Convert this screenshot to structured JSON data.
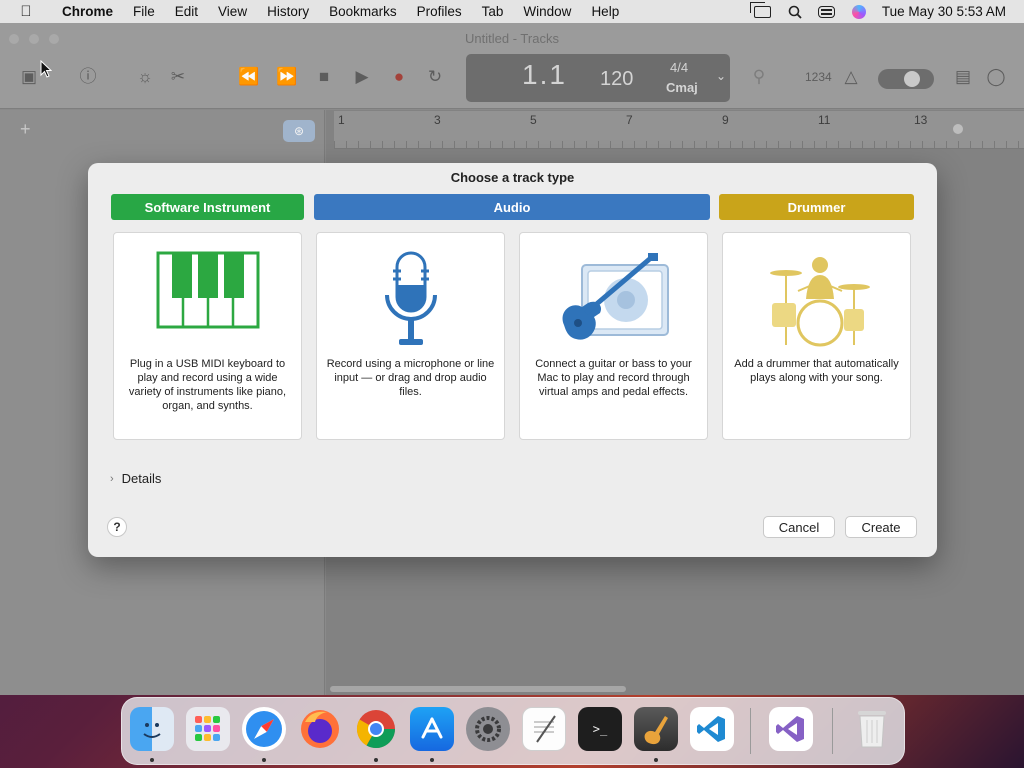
{
  "menubar": {
    "app_name": "Chrome",
    "items": [
      "File",
      "Edit",
      "View",
      "History",
      "Bookmarks",
      "Profiles",
      "Tab",
      "Window",
      "Help"
    ],
    "datetime": "Tue May 30  5:53 AM"
  },
  "window": {
    "title": "Untitled - Tracks",
    "lcd": {
      "position": "1.1",
      "tempo": "120",
      "time_signature": "4/4",
      "key": "Cmaj"
    },
    "ruler_numbers": [
      "1",
      "3",
      "5",
      "7",
      "9",
      "11",
      "13"
    ],
    "counter": "1234"
  },
  "dialog": {
    "title": "Choose a track type",
    "categories": [
      {
        "label": "Software Instrument",
        "color": "#28a745"
      },
      {
        "label": "Audio",
        "color": "#3a78c0"
      },
      {
        "label": "Drummer",
        "color": "#c9a41a"
      }
    ],
    "cards": [
      {
        "name": "software-instrument",
        "desc": "Plug in a USB MIDI keyboard to play and record using a wide variety of instruments like piano, organ, and synths."
      },
      {
        "name": "microphone",
        "desc": "Record using a microphone or line input — or drag and drop audio files."
      },
      {
        "name": "guitar",
        "desc": "Connect a guitar or bass to your Mac to play and record through virtual amps and pedal effects."
      },
      {
        "name": "drummer",
        "desc": "Add a drummer that automatically plays along with your song."
      }
    ],
    "details_label": "Details",
    "help_label": "?",
    "cancel_label": "Cancel",
    "create_label": "Create"
  },
  "dock": {
    "apps": [
      "finder-icon",
      "launchpad-icon",
      "safari-icon",
      "firefox-icon",
      "chrome-icon",
      "app-store-icon",
      "system-settings-icon",
      "textedit-icon",
      "terminal-icon",
      "garageband-icon",
      "vscode-icon",
      "visual-studio-icon",
      "trash-icon"
    ]
  }
}
